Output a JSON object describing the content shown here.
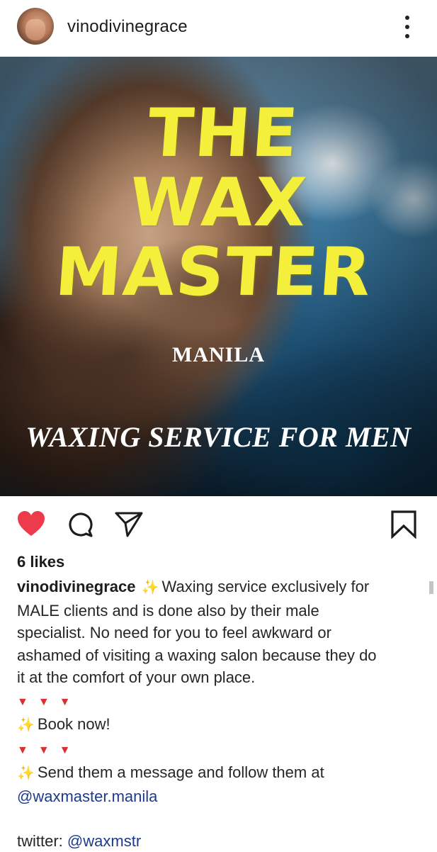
{
  "header": {
    "username": "vinodivinegrace",
    "avatar_icon": "profile-photo-avatar",
    "more_icon": "more-vertical-icon"
  },
  "post_image": {
    "title_lines": [
      "THE",
      "WAX",
      "MASTER"
    ],
    "subtitle": "MANILA",
    "tagline": "WAXING SERVICE FOR MEN",
    "title_color": "#f4ef3a"
  },
  "actions": {
    "like_icon": "heart-filled-icon",
    "like_color": "#ee3b4b",
    "comment_icon": "comment-icon",
    "share_icon": "send-icon",
    "save_icon": "bookmark-icon"
  },
  "likes": "6 likes",
  "caption": {
    "username": "vinodivinegrace",
    "line1": "Waxing service exclusively for",
    "line2": "MALE clients and is done also by their male",
    "line3": "specialist. No need for you to feel awkward or",
    "line4": "ashamed of visiting a waxing salon because they do",
    "line5": "it at the comfort of your own place.",
    "book_now": "Book now!",
    "send_text": "Send them a message and follow them at",
    "instagram_handle": "@waxmaster.manila",
    "twitter_label": "twitter:",
    "twitter_handle": "@waxmstr",
    "sparkle_icon": "sparkles-emoji",
    "triangle_icon": "red-triangle-down-emoji"
  }
}
